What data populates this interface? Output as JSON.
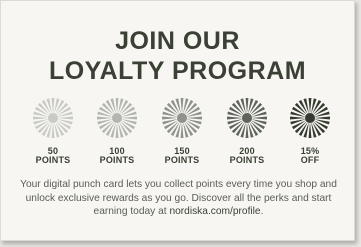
{
  "card": {
    "title_line1": "JOIN OUR",
    "title_line2": "LOYALTY PROGRAM",
    "tiers": [
      {
        "value": "50",
        "unit": "POINTS",
        "icon": "sunburst-icon",
        "color": "#c9cac6"
      },
      {
        "value": "100",
        "unit": "POINTS",
        "icon": "sunburst-icon",
        "color": "#b3b5af"
      },
      {
        "value": "150",
        "unit": "POINTS",
        "icon": "sunburst-icon",
        "color": "#8e928a"
      },
      {
        "value": "200",
        "unit": "POINTS",
        "icon": "sunburst-icon",
        "color": "#5f645a"
      },
      {
        "value": "15%",
        "unit": "OFF",
        "icon": "sunburst-icon",
        "color": "#353a2f"
      }
    ],
    "description": "Your digital punch card lets you collect points every time you shop and unlock exclusive rewards as you go. Discover all the perks and start earning today at ",
    "link_text": "nordiska.com/profile",
    "description_end": "."
  },
  "colors": {
    "background": "#e9e7e2",
    "card": "#f7f6f3",
    "title": "#3a4033",
    "body_text": "#5a5d55"
  }
}
